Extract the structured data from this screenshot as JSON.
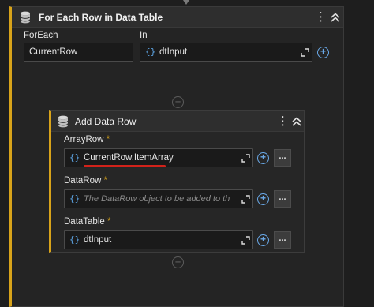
{
  "foreach_activity": {
    "title": "For Each Row in Data Table",
    "foreach_label": "ForEach",
    "foreach_value": "CurrentRow",
    "in_label": "In",
    "in_brace": "{}",
    "in_value": "dtInput"
  },
  "add_data_row": {
    "title": "Add Data Row",
    "required_mark": "*",
    "array_row": {
      "label": "ArrayRow",
      "brace": "{}",
      "value": "CurrentRow.ItemArray"
    },
    "data_row": {
      "label": "DataRow",
      "brace": "{}",
      "placeholder": "The DataRow object to be added to th"
    },
    "data_table": {
      "label": "DataTable",
      "brace": "{}",
      "value": "dtInput"
    },
    "more_button_label": "..."
  },
  "icons": {
    "activity": "database-icon",
    "menu": "kebab-menu-icon",
    "collapse": "chevron-up-double-icon",
    "expand": "expand-editor-icon",
    "plus": "plus-circle-icon",
    "add_activity": "add-activity-icon"
  },
  "colors": {
    "accent": "#d8a31a",
    "brace": "#5ea7e8",
    "annotation": "#d2221a"
  }
}
